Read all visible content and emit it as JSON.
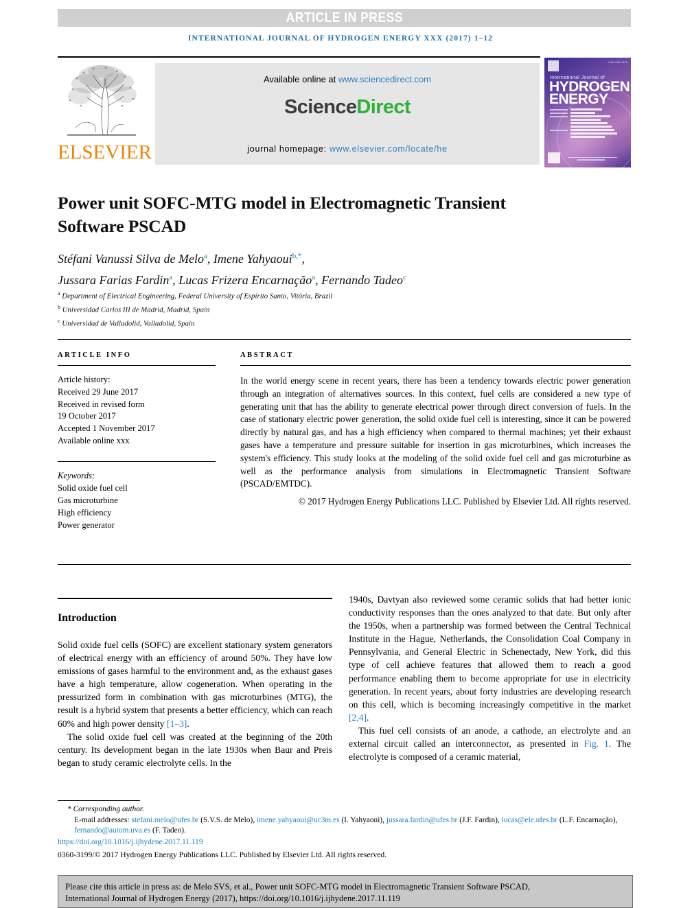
{
  "banner": {
    "article_in_press": "ARTICLE IN PRESS",
    "running_head": "INTERNATIONAL JOURNAL OF HYDROGEN ENERGY XXX (2017) 1–12"
  },
  "masthead": {
    "elsevier_wordmark": "ELSEVIER",
    "available_online_prefix": "Available online at ",
    "sciencedirect_url": "www.sciencedirect.com",
    "sciencedirect_logo_part1": "Science",
    "sciencedirect_logo_part2": "Direct",
    "homepage_label": "journal homepage: ",
    "homepage_url": "www.elsevier.com/locate/he"
  },
  "cover": {
    "superline": "International Journal of",
    "line1": "HYDROGEN",
    "line2": "ENERGY",
    "corner_code": "ISSN 0360-3199"
  },
  "article": {
    "title": "Power unit SOFC-MTG model in Electromagnetic Transient Software PSCAD",
    "authors_line1_names": "Stéfani Vanussi Silva de Melo",
    "authors_line1_sup1": "a",
    "authors_line1_name2": "Imene Yahyaoui",
    "authors_line1_sup2": "b,*",
    "authors_line2_name1": "Jussara Farias Fardin",
    "authors_line2_sup1": "a",
    "authors_line2_name2": "Lucas Frizera Encarnação",
    "authors_line2_sup2": "a",
    "authors_line2_name3": "Fernando Tadeo",
    "authors_line2_sup3": "c",
    "affiliations": [
      {
        "tag": "a",
        "text": "Department of Electrical Engineering, Federal University of Espírito Santo, Vitória, Brazil"
      },
      {
        "tag": "b",
        "text": "Universidad Carlos III de Madrid, Madrid, Spain"
      },
      {
        "tag": "c",
        "text": "Universidad de Valladolid, Valladolid, Spain"
      }
    ]
  },
  "article_info": {
    "label": "ARTICLE INFO",
    "history_heading": "Article history:",
    "history_lines": [
      "Received 29 June 2017",
      "Received in revised form",
      "19 October 2017",
      "Accepted 1 November 2017",
      "Available online xxx"
    ],
    "keywords_heading": "Keywords:",
    "keywords": [
      "Solid oxide fuel cell",
      "Gas microturbine",
      "High efficiency",
      "Power generator"
    ]
  },
  "abstract": {
    "label": "ABSTRACT",
    "text": "In the world energy scene in recent years, there has been a tendency towards electric power generation through an integration of alternatives sources. In this context, fuel cells are considered a new type of generating unit that has the ability to generate electrical power through direct conversion of fuels. In the case of stationary electric power generation, the solid oxide fuel cell is interesting, since it can be powered directly by natural gas, and has a high efficiency when compared to thermal machines; yet their exhaust gases have a temperature and pressure suitable for insertion in gas microturbines, which increases the system's efficiency. This study looks at the modeling of the solid oxide fuel cell and gas microturbine as well as the performance analysis from simulations in Electromagnetic Transient Software (PSCAD/EMTDC).",
    "copyright": "© 2017 Hydrogen Energy Publications LLC. Published by Elsevier Ltd. All rights reserved."
  },
  "body": {
    "section_heading": "Introduction",
    "left_paragraph_1": "Solid oxide fuel cells (SOFC) are excellent stationary system generators of electrical energy with an efficiency of around 50%. They have low emissions of gases harmful to the environment and, as the exhaust gases have a high temperature, allow cogeneration. When operating in the pressurized form in combination with gas microturbines (MTG), the result is a hybrid system that presents a better efficiency, which can reach 60% and high power density ",
    "left_paragraph_1_ref": "[1–3]",
    "left_paragraph_1_tail": ".",
    "left_paragraph_2": "The solid oxide fuel cell was created at the beginning of the 20th century. Its development began in the late 1930s when Baur and Preis began to study ceramic electrolyte cells. In the",
    "right_paragraph_1": "1940s, Davtyan also reviewed some ceramic solids that had better ionic conductivity responses than the ones analyzed to that date. But only after the 1950s, when a partnership was formed between the Central Technical Institute in the Hague, Netherlands, the Consolidation Coal Company in Pennsylvania, and General Electric in Schenectady, New York, did this type of cell achieve features that allowed them to reach a good performance enabling them to become appropriate for use in electricity generation. In recent years, about forty industries are developing research on this cell, which is becoming increasingly competitive in the market ",
    "right_paragraph_1_ref": "[2,4]",
    "right_paragraph_1_tail": ".",
    "right_paragraph_2_a": "This fuel cell consists of an anode, a cathode, an electrolyte and an external circuit called an interconnector, as presented in ",
    "right_paragraph_2_ref": "Fig. 1",
    "right_paragraph_2_b": ". The electrolyte is composed of a ceramic material,"
  },
  "footnote": {
    "corresponding_marker": "*",
    "corresponding_text": "Corresponding author.",
    "emails_label": "E-mail addresses:",
    "emails": [
      {
        "address": "stefani.melo@ufes.br",
        "person": "(S.V.S. de Melo)"
      },
      {
        "address": "imene.yahyaoui@uc3m.es",
        "person": "(I. Yahyaoui)"
      },
      {
        "address": "jussara.fardin@ufes.br",
        "person": "(J.F. Fardin)"
      },
      {
        "address": "lucas@ele.ufes.br",
        "person": "(L.F. Encarnação)"
      },
      {
        "address": "fernando@autom.uva.es",
        "person": "(F. Tadeo)"
      }
    ],
    "doi": "https://doi.org/10.1016/j.ijhydene.2017.11.119",
    "issn_line": "0360-3199/© 2017 Hydrogen Energy Publications LLC. Published by Elsevier Ltd. All rights reserved."
  },
  "cite_box": {
    "line1": "Please cite this article in press as: de Melo SVS, et al., Power unit SOFC-MTG model in Electromagnetic Transient Software PSCAD,",
    "line2": "International Journal of Hydrogen Energy (2017), https://doi.org/10.1016/j.ijhydene.2017.11.119"
  },
  "colors": {
    "link": "#1f7fbf",
    "elsevier_orange": "#ef8200",
    "sciencedirect_green": "#2eb135",
    "banner_gray": "#d0d0d0",
    "cite_box_gray": "#c8c8c8"
  }
}
